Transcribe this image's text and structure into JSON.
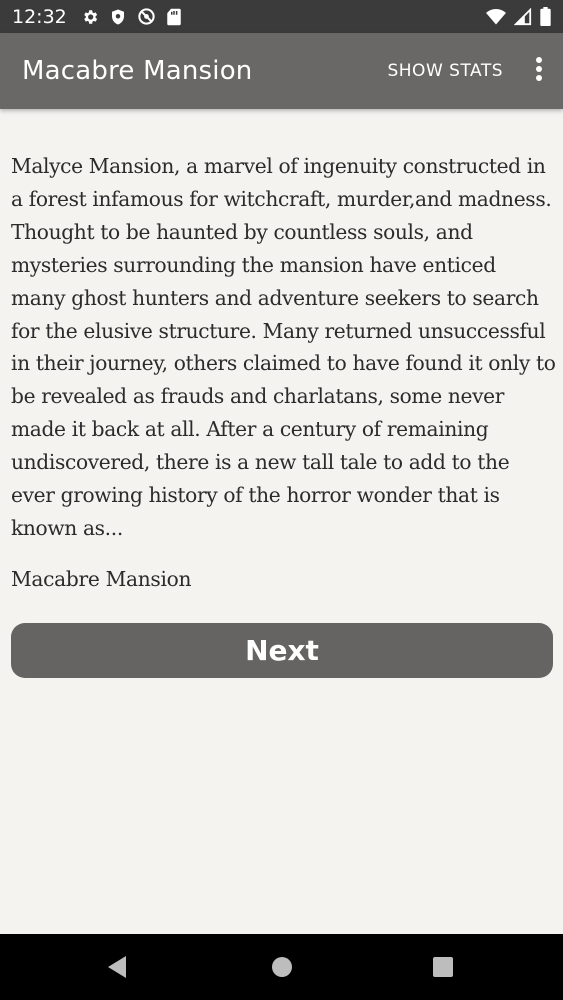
{
  "status_bar": {
    "time": "12:32",
    "icons_left": [
      "settings-gear-icon",
      "shield-icon",
      "vpn-key-icon",
      "sd-card-icon"
    ],
    "icons_right": [
      "wifi-icon",
      "cell-signal-icon",
      "battery-icon"
    ]
  },
  "app_bar": {
    "title": "Macabre Mansion",
    "show_stats_label": "SHOW STATS",
    "overflow_icon": "more-vert-icon"
  },
  "content": {
    "story_text": "Malyce Mansion, a marvel of ingenuity constructed in a forest infamous for witchcraft, murder,and madness. Thought to be haunted by countless souls, and mysteries surrounding the mansion have enticed many ghost hunters and adventure seekers to search for the elusive structure. Many returned unsuccessful in their journey, others claimed to have found it only to be revealed as frauds and charlatans, some never made it back at all. After a century of remaining undiscovered, there is a new tall tale to add to the ever growing history of the horror wonder that is known as...",
    "story_title": "Macabre Mansion",
    "next_label": "Next"
  },
  "nav_bar": {
    "icons": [
      "back-triangle-icon",
      "home-circle-icon",
      "recents-square-icon"
    ]
  },
  "colors": {
    "status_bar": "#3b3b3b",
    "app_bar": "#6a6866",
    "background": "#f5f3f0",
    "button": "#666462",
    "text": "#2b2b2b"
  }
}
